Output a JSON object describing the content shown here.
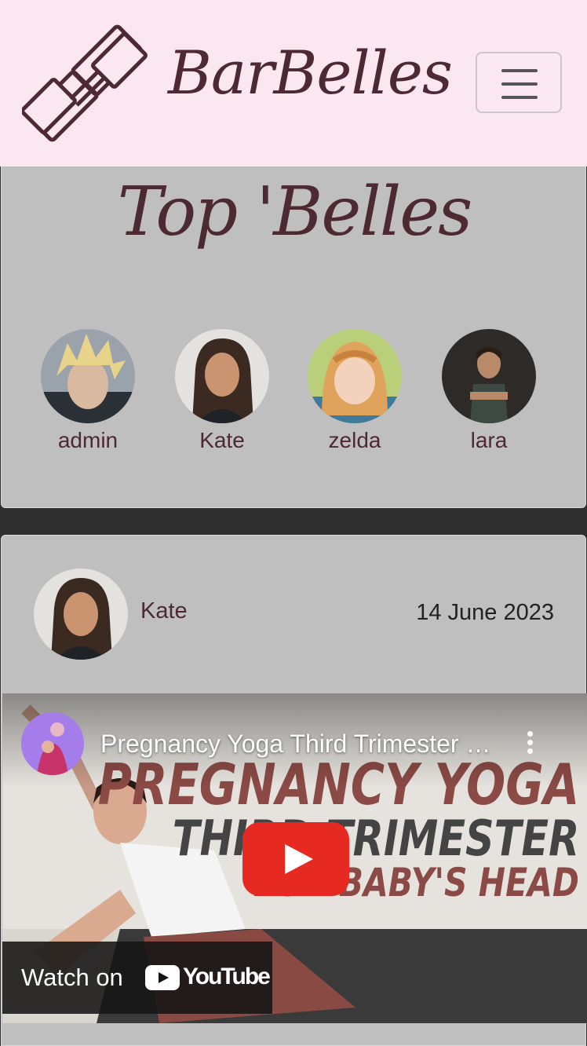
{
  "navbar": {
    "brand": "BarBelles",
    "logo_icon": "dumbbell-icon",
    "toggler_icon": "hamburger-menu-icon"
  },
  "top_belles": {
    "title": "Top 'Belles",
    "users": [
      {
        "name": "admin"
      },
      {
        "name": "Kate"
      },
      {
        "name": "zelda"
      },
      {
        "name": "lara"
      }
    ]
  },
  "post": {
    "author": "Kate",
    "date": "14 June 2023",
    "video": {
      "title": "Pregnancy Yoga Third Trimester For Baby's Head",
      "thumbnail_lines": [
        "PREGNANCY YOGA",
        "THIRD TRIMESTER",
        "FOR BABY'S HEAD"
      ],
      "watch_on": "Watch on",
      "youtube_word": "YouTube",
      "play_icon": "play-icon",
      "more_icon": "more-vertical-icon"
    }
  },
  "colors": {
    "navbar_bg": "#fbe7ef",
    "brand": "#4d2933",
    "card_bg": "#bfbfbf",
    "page_bg": "#2f2f2f",
    "youtube_red": "#e62a22"
  }
}
